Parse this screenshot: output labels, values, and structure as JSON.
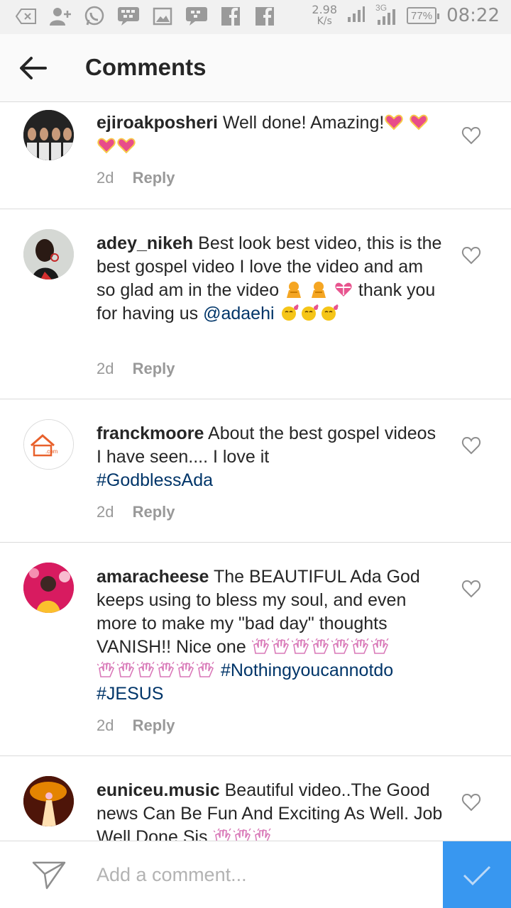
{
  "status_bar": {
    "icons": [
      "notification-icon",
      "add-contact-icon",
      "whatsapp-icon",
      "bbm-icon",
      "gallery-icon",
      "bbm-chat-icon",
      "facebook-icon",
      "facebook-icon"
    ],
    "net_speed_value": "2.98",
    "net_speed_unit": "K/s",
    "network_label": "3G",
    "battery": "77%",
    "time": "08:22"
  },
  "header": {
    "title": "Comments",
    "back_icon": "arrow-left-icon"
  },
  "comments": [
    {
      "username": "ejiroakposheri",
      "text": "Well done! Amazing!",
      "emojis_after_text": [
        "sparkling-heart",
        "sparkling-heart",
        "sparkling-heart",
        "sparkling-heart"
      ],
      "time": "2d",
      "reply_label": "Reply"
    },
    {
      "username": "adey_nikeh",
      "text": "Best look  best video, this is the best gospel video  I love the video and am so glad am in the video",
      "emojis_inline": [
        "person-bowing",
        "person-bowing",
        "heart-with-ribbon"
      ],
      "text_after_emojis": "thank you for having us",
      "mention": "@adaehi",
      "emojis_after_mention": [
        "kissing-heart-face",
        "kissing-heart-face",
        "kissing-heart-face"
      ],
      "time": "2d",
      "reply_label": "Reply"
    },
    {
      "username": "franckmoore",
      "text": "About the best gospel videos I have seen.... I love it",
      "hashtag": "#GodblessAda",
      "time": "2d",
      "reply_label": "Reply"
    },
    {
      "username": "amaracheese",
      "text": "The BEAUTIFUL Ada God keeps using to bless my soul, and even more to make my \"bad day\" thoughts VANISH!! Nice one",
      "emojis_clap_count": 13,
      "hashtags": [
        "#Nothingyoucannotdo",
        "#JESUS"
      ],
      "time": "2d",
      "reply_label": "Reply"
    },
    {
      "username": "euniceu.music",
      "text": "Beautiful video..The Good news Can Be Fun And Exciting As Well. Job Well Done Sis",
      "emojis_after_text": [
        "clapping-hands",
        "clapping-hands",
        "clapping-hands"
      ]
    }
  ],
  "composer": {
    "placeholder": "Add a comment...",
    "send_icon": "direct-send-icon",
    "post_icon": "checkmark-icon"
  },
  "colors": {
    "link": "#003569",
    "meta": "#999999",
    "post_button": "#3897f0",
    "divider": "#dbdbdb"
  }
}
